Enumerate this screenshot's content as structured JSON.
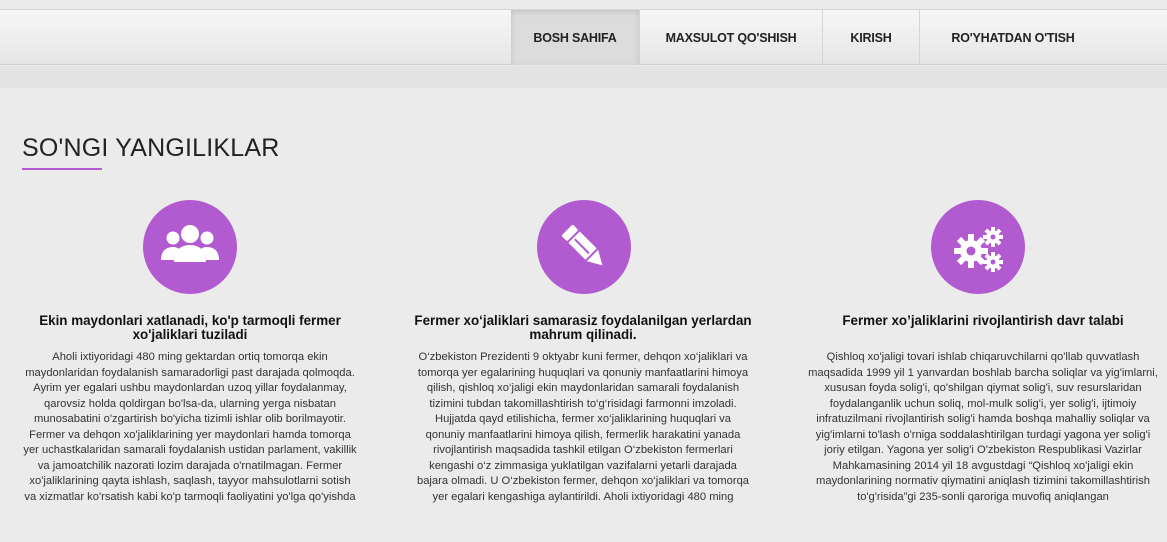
{
  "nav": {
    "items": [
      {
        "label": "BOSH SAHIFA"
      },
      {
        "label": "MAXSULOT QO'SHISH"
      },
      {
        "label": "KIRISH"
      },
      {
        "label": "RO'YHATDAN O'TISH"
      }
    ]
  },
  "section": {
    "title": "SO'NGI YANGILIKLAR"
  },
  "colors": {
    "accent": "#b25ad0"
  },
  "articles": [
    {
      "icon": "users-icon",
      "title": "Ekin maydonlari xatlanadi, ko'p tarmoqli fermer xo'jaliklari tuziladi",
      "body": "Aholi ixtiyoridagi 480 ming gektardan ortiq tomorqa ekin maydonlaridan foydalanish samaradorligi past darajada qolmoqda. Ayrim yer egalari ushbu maydonlardan uzoq yillar foydalanmay, qarovsiz holda qoldirgan bo'lsa-da, ularning yerga nisbatan munosabatini o'zgartirish bo'yicha tizimli ishlar olib borilmayotir. Fermer va dehqon xo'jaliklarining yer maydonlari hamda tomorqa yer uchastkalaridan samarali foydalanish ustidan parlament, vakillik va jamoatchilik nazorati lozim darajada o'rnatilmagan. Fermer xo'jaliklarining qayta ishlash, saqlash, tayyor mahsulotlarni sotish va xizmatlar ko'rsatish kabi ko'p tarmoqli faoliyatini yo'lga qo'yishda"
    },
    {
      "icon": "pencil-icon",
      "title": "Fermer xo‘jaliklari samarasiz foydalanilgan yerlardan mahrum qilinadi.",
      "body": "O‘zbekiston Prezidenti 9 oktyabr kuni fermer, dehqon xo‘jaliklari va tomorqa yer egalarining huquqlari va qonuniy manfaatlarini himoya qilish, qishloq xo‘jaligi ekin maydonlaridan samarali foydalanish tizimini tubdan takomillashtirish to‘g‘risidagi farmonni imzoladi. Hujjatda qayd etilishicha, fermer xo‘jaliklarining huquqlari va qonuniy manfaatlarini himoya qilish, fermerlik harakatini yanada rivojlantirish maqsadida tashkil etilgan O‘zbekiston fermerlari kengashi o‘z zimmasiga yuklatilgan vazifalarni yetarli darajada bajara olmadi. U O‘zbekiston fermer, dehqon xo‘jaliklari va tomorqa yer egalari kengashiga aylantirildi. Aholi ixtiyoridagi 480 ming"
    },
    {
      "icon": "gears-icon",
      "title": "Fermer xo’jaliklarini rivojlantirish davr talabi",
      "body": "Qishloq xo'jaligi tovari ishlab chiqaruvchilarni qo'llab quvvatlash maqsadida 1999 yil 1 yanvardan boshlab barcha soliqlar va yig'imlarni, xususan foyda solig'i, qo'shilgan qiymat solig'i, suv resurslaridan foydalanganlik uchun soliq, mol-mulk solig'i, yer solig'i, ijtimoiy infratuzilmani rivojlantirish solig'i hamda boshqa mahalliy soliqlar va yig'imlarni to'lash o'rniga soddalashtirilgan turdagi yagona yer solig'i joriy etilgan. Yagona yer solig'i O'zbekiston Respublikasi Vazirlar Mahkamasining 2014 yil 18 avgustdagi “Qishloq xo'jaligi ekin maydonlarining normativ qiymatini aniqlash tizimini takomillashtirish to'g'risida”gi 235-sonli qaroriga muvofiq aniqlangan"
    }
  ]
}
